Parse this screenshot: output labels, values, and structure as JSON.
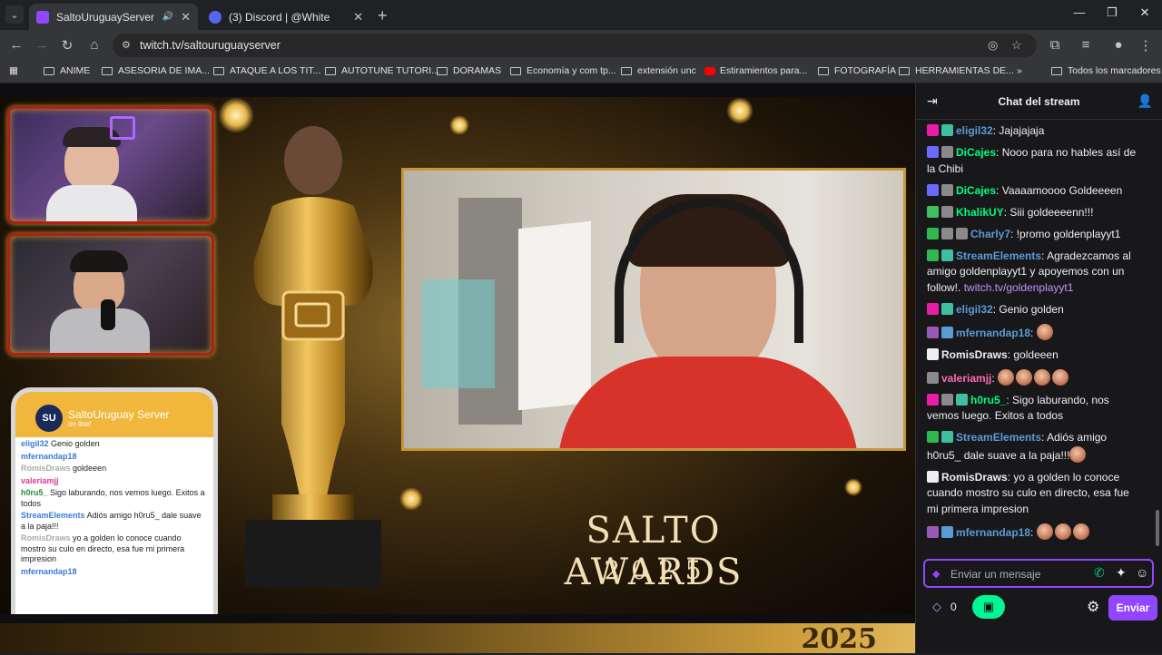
{
  "browser": {
    "tabs": [
      {
        "title": "SaltoUruguayServer - Twitc",
        "favicon_color": "#9147ff",
        "active": true
      },
      {
        "title": "(3) Discord | @White",
        "favicon_color": "#5865f2",
        "active": false
      }
    ],
    "url": "twitch.tv/saltouruguayserver",
    "bookmarks": [
      {
        "label": "ANIME",
        "icon": "folder-icon"
      },
      {
        "label": "ASESORIA DE IMA...",
        "icon": "folder-icon"
      },
      {
        "label": "ATAQUE A LOS TIT...",
        "icon": "folder-icon"
      },
      {
        "label": "AUTOTUNE TUTORI...",
        "icon": "folder-icon"
      },
      {
        "label": "DORAMAS",
        "icon": "folder-icon"
      },
      {
        "label": "Economía y com tp...",
        "icon": "folder-icon"
      },
      {
        "label": "extensión unc",
        "icon": "folder-icon"
      },
      {
        "label": "Estiramientos para...",
        "icon": "youtube-icon"
      },
      {
        "label": "FOTOGRAFÍA",
        "icon": "folder-icon"
      },
      {
        "label": "HERRAMIENTAS DE...",
        "icon": "folder-icon"
      }
    ],
    "all_bookmarks": "Todos los marcadores"
  },
  "stream": {
    "title_line1": "SALTO AWARDS",
    "title_line2": "2025",
    "bottom_year": "2025",
    "phone": {
      "channel": "SaltoUruguay Server",
      "status": "on line!",
      "logo": "SU",
      "messages": [
        {
          "user": "eligil32",
          "text": "Genio golden",
          "color": "#3a7bd5"
        },
        {
          "user": "mfernandap18",
          "text": "",
          "color": "#3a7bd5"
        },
        {
          "user": "RomisDraws",
          "text": "goldeeen",
          "color": "#aaaaaa"
        },
        {
          "user": "valeriamjj",
          "text": "",
          "color": "#d63b9a"
        },
        {
          "user": "h0ru5_",
          "text": "Sigo laburando, nos vemos luego. Exitos a todos",
          "color": "#2a8a3a"
        },
        {
          "user": "StreamElements",
          "text": "Adiós amigo h0ru5_ dale suave a la paja!!!",
          "color": "#3a7bd5"
        },
        {
          "user": "RomisDraws",
          "text": "yo a golden lo conoce cuando mostro su culo en directo, esa fue mi primera impresion",
          "color": "#aaaaaa"
        },
        {
          "user": "mfernandap18",
          "text": "",
          "color": "#3a7bd5"
        }
      ]
    }
  },
  "chat": {
    "title": "Chat del stream",
    "messages": [
      {
        "user": "eligil32",
        "color": "#5b9bd5",
        "text": "Jajajajaja",
        "badges": [
          "#e91ea6",
          "#3fbf9f"
        ]
      },
      {
        "user": "DiCajes",
        "color": "#00ff7f",
        "text": "Nooo para no hables así de la Chibi",
        "badges": [
          "#6a6aff",
          "#8a8a8a"
        ]
      },
      {
        "user": "DiCajes",
        "color": "#00ff7f",
        "text": "Vaaaamoooo Goldeeeen",
        "badges": [
          "#6a6aff",
          "#8a8a8a"
        ]
      },
      {
        "user": "KhalikUY",
        "color": "#00ff7f",
        "text": "Siii goldeeeenn!!!",
        "badges": [
          "#3fbf5f",
          "#8a8a8a"
        ]
      },
      {
        "user": "Charly7",
        "color": "#5b9bd5",
        "text": "!promo goldenplayyt1",
        "badges": [
          "#2fb84f",
          "#8a8a8a",
          "#8a8a8a"
        ]
      },
      {
        "user": "StreamElements",
        "color": "#5b9bd5",
        "text": "Agradezcamos al amigo goldenplayyt1 y apoyemos con un follow!.",
        "link": "twitch.tv/goldenplayyt1",
        "badges": [
          "#2fb84f",
          "#3fbf9f"
        ]
      },
      {
        "user": "eligil32",
        "color": "#5b9bd5",
        "text": "Genio golden",
        "badges": [
          "#e91ea6",
          "#3fbf9f"
        ]
      },
      {
        "user": "mfernandap18",
        "color": "#5b9bd5",
        "text": "",
        "emotes": 1,
        "badges": [
          "#9b59b6",
          "#5b9bd5"
        ]
      },
      {
        "user": "RomisDraws",
        "color": "#efeff1",
        "text": "goldeeen",
        "badges": [
          "#efeff1"
        ]
      },
      {
        "user": "valeriamjj",
        "color": "#ff69b4",
        "text": "",
        "emotes": 4,
        "badges": [
          "#8a8a8a"
        ]
      },
      {
        "user": "h0ru5_",
        "color": "#00ff7f",
        "text": "Sigo laburando, nos vemos luego. Exitos a todos",
        "badges": [
          "#e91ea6",
          "#8a8a8a",
          "#3fbf9f"
        ]
      },
      {
        "user": "StreamElements",
        "color": "#5b9bd5",
        "text": "Adiós amigo h0ru5_ dale suave a la paja!!!",
        "emotes": 1,
        "badges": [
          "#2fb84f",
          "#3fbf9f"
        ]
      },
      {
        "user": "RomisDraws",
        "color": "#efeff1",
        "text": "yo a golden lo conoce cuando mostro su culo en directo, esa fue mi primera impresion",
        "badges": [
          "#efeff1"
        ]
      },
      {
        "user": "mfernandap18",
        "color": "#5b9bd5",
        "text": "",
        "emotes": 3,
        "badges": [
          "#9b59b6",
          "#5b9bd5"
        ]
      }
    ],
    "input_placeholder": "Enviar un mensaje",
    "bits_count": "0",
    "send_label": "Enviar"
  },
  "colors": {
    "accent": "#9147ff",
    "promo": "#00f593",
    "gold": "#c8963a"
  }
}
